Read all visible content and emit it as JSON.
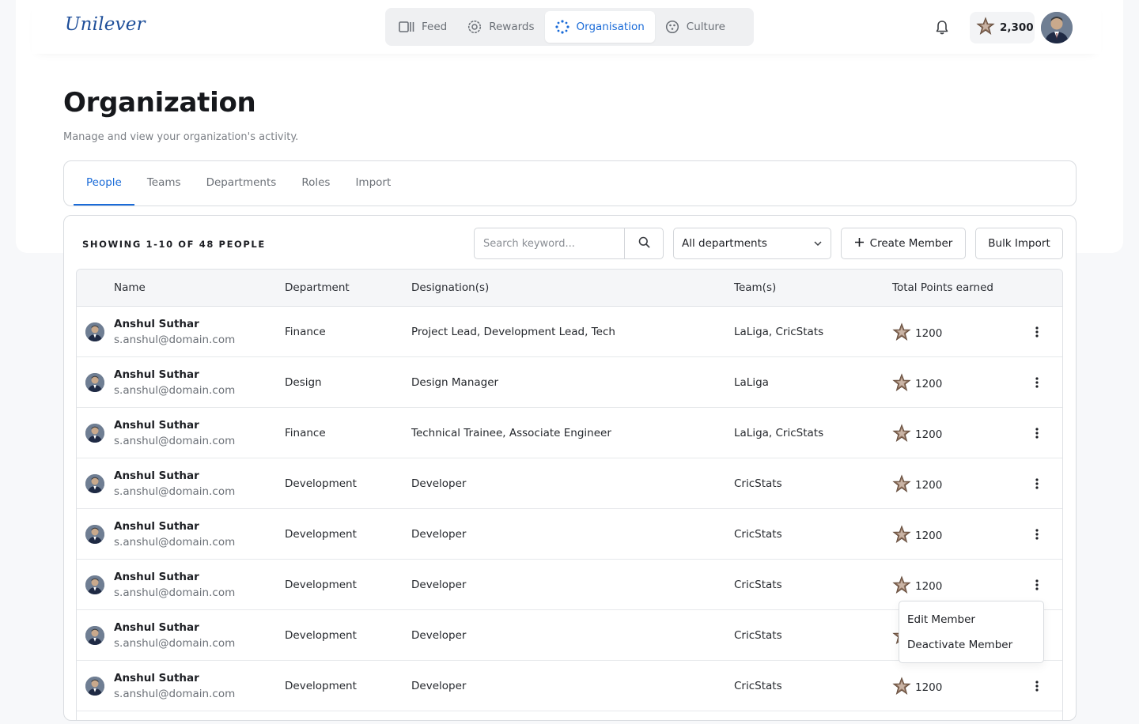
{
  "brand": {
    "logo_text": "Unilever"
  },
  "nav": {
    "items": [
      {
        "label": "Feed",
        "icon": "feed-icon"
      },
      {
        "label": "Rewards",
        "icon": "rewards-icon"
      },
      {
        "label": "Organisation",
        "icon": "organisation-icon",
        "active": true
      },
      {
        "label": "Culture",
        "icon": "culture-icon"
      }
    ]
  },
  "header": {
    "points": "2,300"
  },
  "page": {
    "title": "Organization",
    "subtitle": "Manage and view your organization's activity."
  },
  "tabs": [
    "People",
    "Teams",
    "Departments",
    "Roles",
    "Import"
  ],
  "toolbar": {
    "showing": "SHOWING 1-10 OF 48 PEOPLE",
    "search_placeholder": "Search keyword...",
    "department_filter": "All departments",
    "create_label": "Create Member",
    "bulk_label": "Bulk Import"
  },
  "table": {
    "columns": [
      "Name",
      "Department",
      "Designation(s)",
      "Team(s)",
      "Total Points earned"
    ],
    "rows": [
      {
        "name": "Anshul Suthar",
        "email": "s.anshul@domain.com",
        "department": "Finance",
        "designation": "Project Lead, Development Lead, Tech",
        "teams": "LaLiga, CricStats",
        "points": "1200"
      },
      {
        "name": "Anshul Suthar",
        "email": "s.anshul@domain.com",
        "department": "Design",
        "designation": "Design Manager",
        "teams": "LaLiga",
        "points": "1200"
      },
      {
        "name": "Anshul Suthar",
        "email": "s.anshul@domain.com",
        "department": "Finance",
        "designation": "Technical Trainee, Associate Engineer",
        "teams": "LaLiga, CricStats",
        "points": "1200"
      },
      {
        "name": "Anshul Suthar",
        "email": "s.anshul@domain.com",
        "department": "Development",
        "designation": "Developer",
        "teams": "CricStats",
        "points": "1200"
      },
      {
        "name": "Anshul Suthar",
        "email": "s.anshul@domain.com",
        "department": "Development",
        "designation": "Developer",
        "teams": "CricStats",
        "points": "1200"
      },
      {
        "name": "Anshul Suthar",
        "email": "s.anshul@domain.com",
        "department": "Development",
        "designation": "Developer",
        "teams": "CricStats",
        "points": "1200"
      },
      {
        "name": "Anshul Suthar",
        "email": "s.anshul@domain.com",
        "department": "Development",
        "designation": "Developer",
        "teams": "CricStats",
        "points": ""
      },
      {
        "name": "Anshul Suthar",
        "email": "s.anshul@domain.com",
        "department": "Development",
        "designation": "Developer",
        "teams": "CricStats",
        "points": "1200"
      }
    ]
  },
  "row_menu": {
    "items": [
      "Edit Member",
      "Deactivate Member"
    ]
  },
  "colors": {
    "accent": "#1a6bd8",
    "brand": "#1f4f9a"
  }
}
